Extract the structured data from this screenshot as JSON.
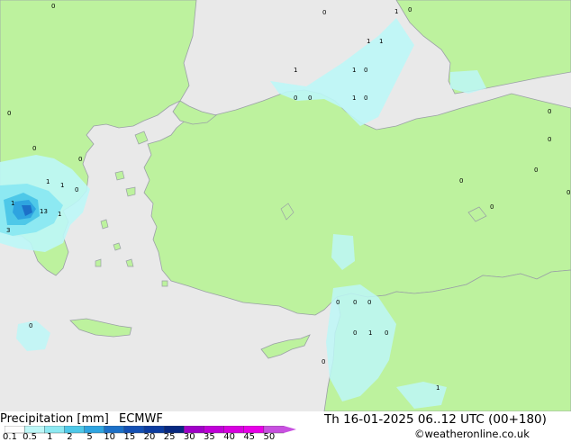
{
  "legend": {
    "title": "Precipitation [mm]",
    "model": "ECMWF",
    "ticks": [
      "0.1",
      "0.5",
      "1",
      "2",
      "5",
      "10",
      "15",
      "20",
      "25",
      "30",
      "35",
      "40",
      "45",
      "50"
    ],
    "colors": [
      "#fdfdfd",
      "#bdf7f7",
      "#8de9f2",
      "#4ec8e8",
      "#2ea4e0",
      "#1c70c8",
      "#1450b4",
      "#0c3ca0",
      "#082880",
      "#a000c8",
      "#c000d8",
      "#d800e0",
      "#e800e8",
      "#c850e0"
    ]
  },
  "valid_time": "Th 16-01-2025 06..12 UTC (00+180)",
  "credit": "©weatheronline.co.uk",
  "map": {
    "land_color": "#bdf29e",
    "sea_color": "#e9e9e9",
    "border_color": "#9aa0a6",
    "labels": [
      "0",
      "0",
      "1",
      "1",
      "1",
      "1",
      "1",
      "0",
      "0",
      "0",
      "1",
      "0",
      "0",
      "0",
      "0",
      "1",
      "1",
      "0",
      "0",
      "1",
      "13",
      "1",
      "3",
      "0",
      "0",
      "0",
      "0",
      "0",
      "0",
      "1",
      "0",
      "0",
      "0",
      "0",
      "0",
      "0",
      "1",
      "0"
    ]
  }
}
